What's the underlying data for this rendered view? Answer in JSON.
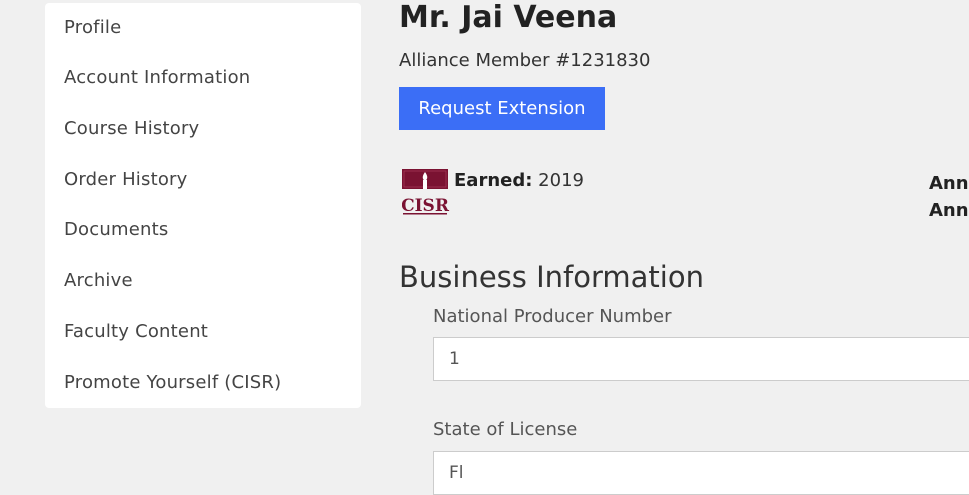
{
  "sidebar": {
    "items": [
      {
        "label": "Profile"
      },
      {
        "label": "Account Information"
      },
      {
        "label": "Course History"
      },
      {
        "label": "Order History"
      },
      {
        "label": "Documents"
      },
      {
        "label": "Archive"
      },
      {
        "label": "Faculty Content"
      },
      {
        "label": "Promote Yourself (CISR)"
      }
    ]
  },
  "profile": {
    "name": "Mr. Jai Veena",
    "member_number": "Alliance Member #1231830",
    "request_extension_label": "Request Extension"
  },
  "designation": {
    "logo_text": "CISR",
    "earned_label": "Earned:",
    "earned_year": "2019",
    "right_labels": [
      "Ann",
      "Ann"
    ]
  },
  "business": {
    "section_title": "Business Information",
    "npn_label": "National Producer Number",
    "npn_value": "1",
    "state_label": "State of License",
    "state_value": "Fl"
  },
  "colors": {
    "accent": "#3b6ef6",
    "cisr_maroon": "#7a1232"
  }
}
